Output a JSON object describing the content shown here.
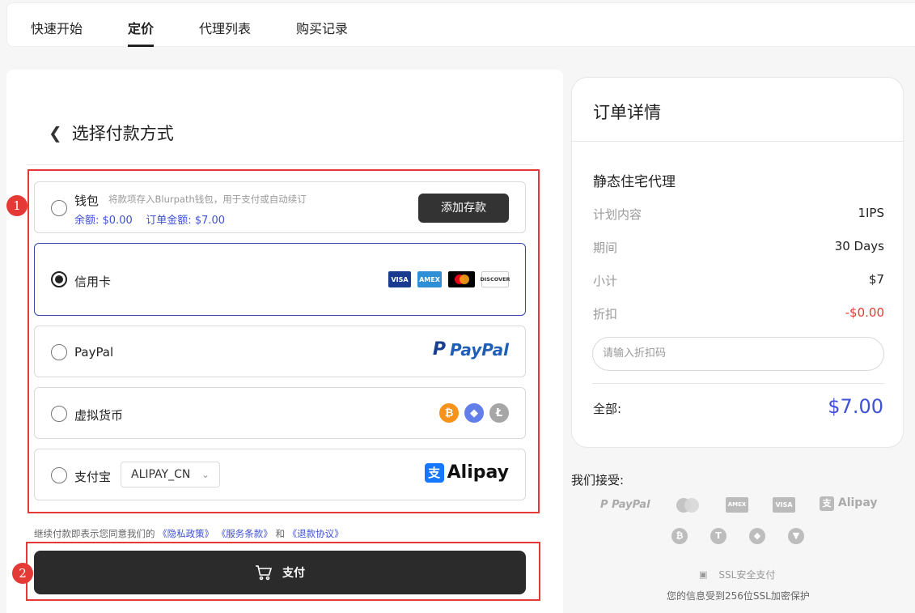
{
  "nav": {
    "tabs": [
      {
        "label": "快速开始"
      },
      {
        "label": "定价"
      },
      {
        "label": "代理列表"
      },
      {
        "label": "购买记录"
      }
    ]
  },
  "payment": {
    "title": "选择付款方式",
    "wallet": {
      "label": "钱包",
      "description": "将款项存入Blurpath钱包，用于支付或自动续订",
      "balance_label": "余额:",
      "balance": "$0.00",
      "order_amount_label": "订单金额:",
      "order_amount": "$7.00",
      "add_button": "添加存款"
    },
    "credit_card": {
      "label": "信用卡",
      "logos": [
        "VISA",
        "AMEX",
        "mastercard",
        "DISCOVER"
      ]
    },
    "paypal": {
      "label": "PayPal",
      "logo_text": "PayPal"
    },
    "crypto": {
      "label": "虚拟货币"
    },
    "alipay": {
      "label": "支付宝",
      "select_value": "ALIPAY_CN",
      "logo_text": "Alipay"
    },
    "selected": "credit_card",
    "terms_prefix": "继续付款即表示您同意我们的",
    "privacy_link": "《隐私政策》",
    "service_link": "《服务条款》",
    "and_text": "和",
    "refund_link": "《退款协议》",
    "pay_button": "支付"
  },
  "order": {
    "title": "订单详情",
    "product": "静态住宅代理",
    "rows": [
      {
        "key": "计划内容",
        "value": "1IPS"
      },
      {
        "key": "期间",
        "value": "30 Days"
      },
      {
        "key": "小计",
        "value": "$7"
      },
      {
        "key": "折扣",
        "value": "-$0.00"
      }
    ],
    "coupon_placeholder": "请输入折扣码",
    "total_label": "全部:",
    "total_value": "$7.00"
  },
  "accept": {
    "title": "我们接受:",
    "paypal": "PayPal",
    "amex": "AMEX",
    "visa": "VISA",
    "alipay": "Alipay",
    "ssl_label": "SSL安全支付",
    "ssl_note": "您的信息受到256位SSL加密保护"
  },
  "annotations": [
    "1",
    "2"
  ],
  "colors": {
    "accent": "#3f51d4",
    "annotation": "#e53935",
    "primary_button": "#2b2b2b",
    "discount": "#e53935"
  }
}
